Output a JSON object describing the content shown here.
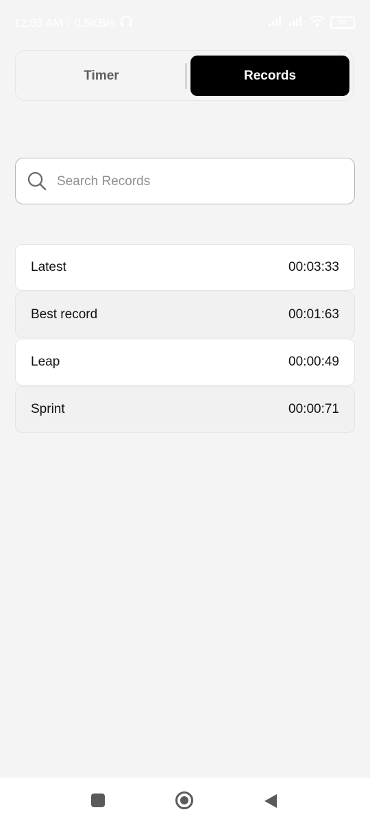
{
  "status_bar": {
    "time": "12:03 AM",
    "speed": "0.5KB/s",
    "battery": "69",
    "colors": {
      "text": "#ffffff"
    }
  },
  "segmented_control": {
    "tabs": [
      {
        "label": "Timer",
        "selected": false
      },
      {
        "label": "Records",
        "selected": true
      }
    ],
    "colors": {
      "selected_bg": "#000000",
      "selected_text": "#ffffff",
      "unselected_text": "#5d5d5d"
    }
  },
  "search": {
    "placeholder": "Search Records",
    "value": "",
    "icon": "search-icon"
  },
  "records": [
    {
      "name": "Latest",
      "time": "00:03:33"
    },
    {
      "name": "Best record",
      "time": "00:01:63"
    },
    {
      "name": "Leap",
      "time": "00:00:49"
    },
    {
      "name": "Sprint",
      "time": "00:00:71"
    }
  ],
  "nav_bar": {
    "icons": [
      "recents-square-icon",
      "home-circle-icon",
      "back-triangle-icon"
    ]
  },
  "colors": {
    "background": "#f4f4f4",
    "row_alt": "#f1f1f1",
    "row": "#ffffff"
  }
}
